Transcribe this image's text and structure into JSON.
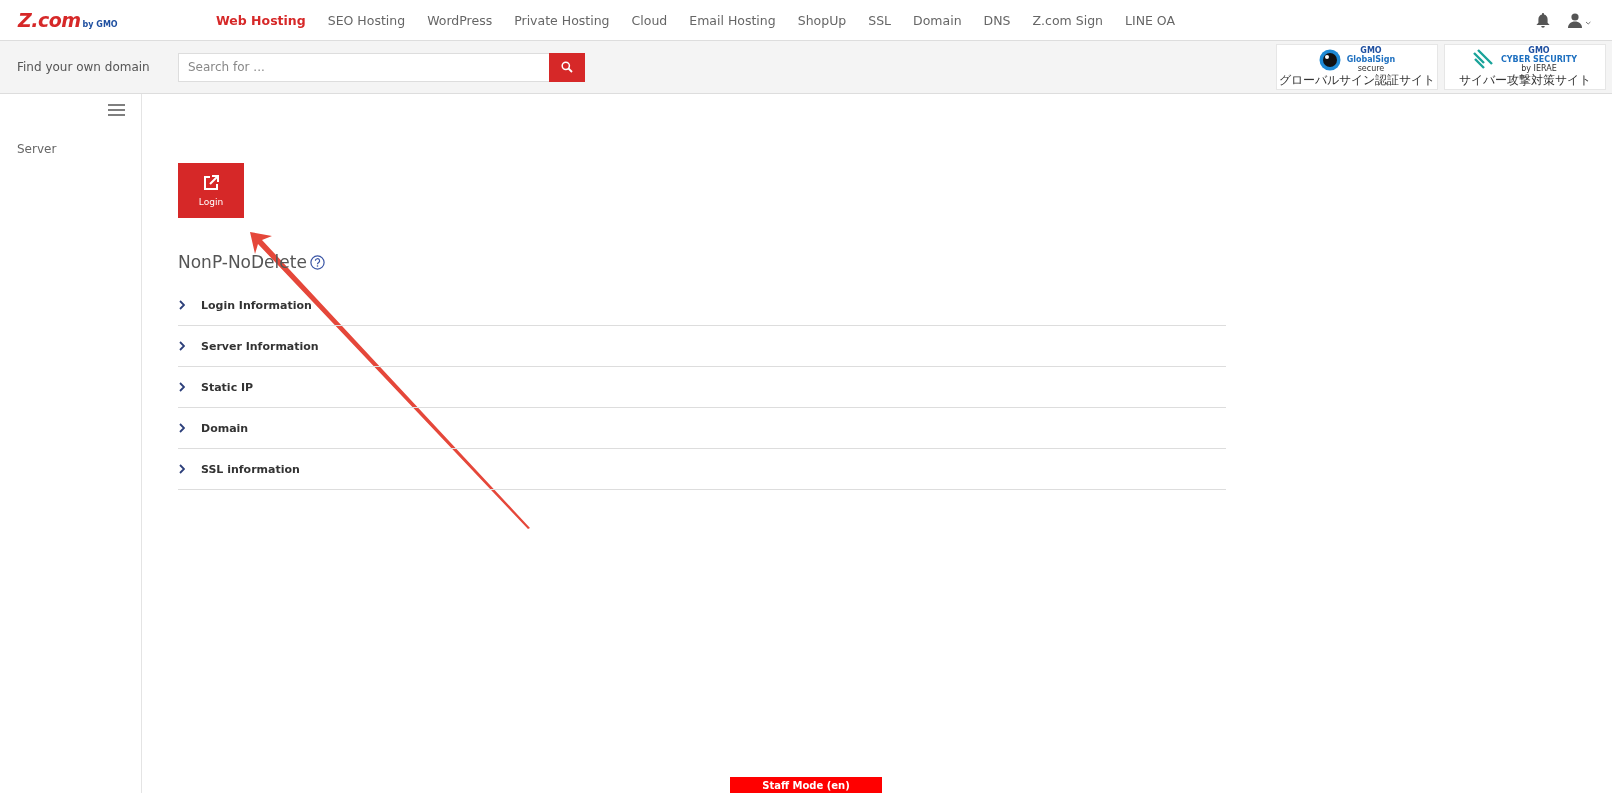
{
  "logo": {
    "brand": "Z.com",
    "byline": "by GMO"
  },
  "nav": [
    {
      "label": "Web Hosting",
      "selected": true
    },
    {
      "label": "SEO Hosting",
      "selected": false
    },
    {
      "label": "WordPress",
      "selected": false
    },
    {
      "label": "Private Hosting",
      "selected": false
    },
    {
      "label": "Cloud",
      "selected": false
    },
    {
      "label": "Email Hosting",
      "selected": false
    },
    {
      "label": "ShopUp",
      "selected": false
    },
    {
      "label": "SSL",
      "selected": false
    },
    {
      "label": "Domain",
      "selected": false
    },
    {
      "label": "DNS",
      "selected": false
    },
    {
      "label": "Z.com Sign",
      "selected": false
    },
    {
      "label": "LINE OA",
      "selected": false
    }
  ],
  "search_bar": {
    "label": "Find your own domain",
    "placeholder": "Search for ..."
  },
  "badges": [
    {
      "kind": "globalsign",
      "lines": [
        "GMO",
        "GlobalSign",
        "secure"
      ],
      "caption": "グローバルサイン認証サイト"
    },
    {
      "kind": "cyber",
      "lines": [
        "GMO",
        "CYBER SECURITY",
        "by IERAE"
      ],
      "caption": "サイバー攻撃対策サイト"
    }
  ],
  "sidebar": {
    "items": [
      {
        "label": "Server"
      }
    ]
  },
  "login_button": {
    "label": "Login"
  },
  "title": "NonP-NoDelete",
  "sections": [
    {
      "label": "Login Information",
      "expanded": false
    },
    {
      "label": "Server Information",
      "expanded": false
    },
    {
      "label": "Static IP",
      "expanded": false
    },
    {
      "label": "Domain",
      "expanded": false
    },
    {
      "label": "SSL information",
      "expanded": false
    }
  ],
  "staff_mode": "Staff Mode (en)"
}
